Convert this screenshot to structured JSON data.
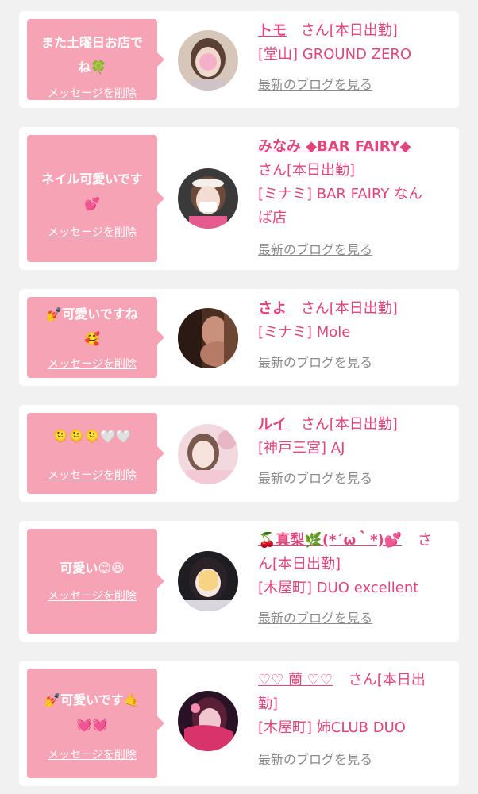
{
  "colors": {
    "background": "#f1f1f1",
    "card": "#ffffff",
    "bubble": "#f7a3b6",
    "accent": "#e0457b",
    "link_gray": "#8a8a8a"
  },
  "labels": {
    "delete": "メッセージを削除",
    "blog": "最新のブログを見る"
  },
  "cards": [
    {
      "message_line1": "また土曜日お店で",
      "message_line2": "ね🍀",
      "name": "トモ",
      "status": "さん[本日出勤]",
      "shop": "[堂山] GROUND ZERO"
    },
    {
      "message_line1": "ネイル可愛いです",
      "message_line2": "💕",
      "name": "みなみ ◆BAR FAIRY◆",
      "status": "さん[本日出勤]",
      "shop_line1": "[ミナミ] BAR FAIRY なん",
      "shop_line2": "ば店"
    },
    {
      "message_line1": "💅可愛いですね",
      "message_line2": "🥰",
      "name": "さよ",
      "status": "さん[本日出勤]",
      "shop": "[ミナミ] Mole"
    },
    {
      "message_line1": "🫠🫠🫠🤍🤍",
      "name": "ルイ",
      "status": "さん[本日出勤]",
      "shop": "[神戸三宮] AJ"
    },
    {
      "message_line1": "可愛い😊😆",
      "name": "🍒真梨🌿(*´ω｀*)💕",
      "status_line1": "さ",
      "status_line2": "ん[本日出勤]",
      "shop": "[木屋町] DUO excellent"
    },
    {
      "message_line1": "💅可愛いです🤙",
      "message_line2": "💓💓",
      "name": "♡♡ 蘭 ♡♡",
      "status_line1": "さん[本日出",
      "status_line2": "勤]",
      "shop": "[木屋町] 姉CLUB DUO"
    }
  ]
}
